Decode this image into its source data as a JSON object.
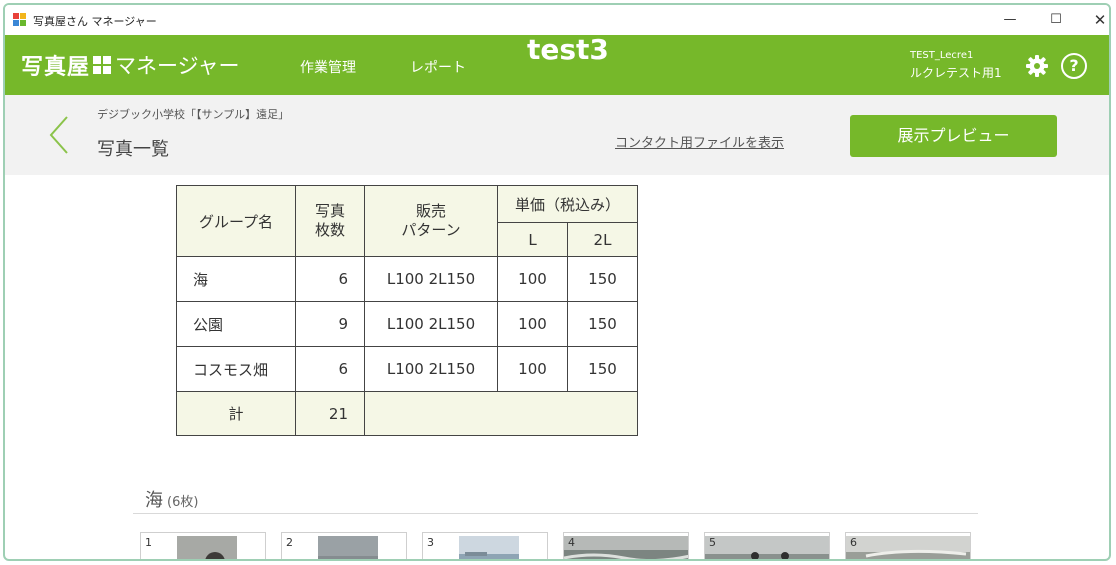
{
  "window": {
    "title": "写真屋さん マネージャー",
    "minimize": "—",
    "maximize": "☐",
    "close": "✕"
  },
  "header": {
    "brand_kanji": "写真屋",
    "brand_kana": "マネージャー",
    "nav": [
      "作業管理",
      "レポート"
    ],
    "center_label": "test3",
    "user_id": "TEST_Lecre1",
    "user_name": "ルクレテスト用1",
    "help_label": "?"
  },
  "subheader": {
    "breadcrumb": "デジブック小学校「【サンプル】遠足」",
    "title": "写真一覧",
    "contact_link": "コンタクト用ファイルを表示",
    "preview_button": "展示プレビュー"
  },
  "table": {
    "headers": {
      "group": "グループ名",
      "count": "写真\n枚数",
      "pattern": "販売\nパターン",
      "unit_price": "単価（税込み）",
      "price_l": "L",
      "price_2l": "2L"
    },
    "rows": [
      {
        "group": "海",
        "count": "6",
        "pattern": "L100 2L150",
        "l": "100",
        "l2": "150"
      },
      {
        "group": "公園",
        "count": "9",
        "pattern": "L100 2L150",
        "l": "100",
        "l2": "150"
      },
      {
        "group": "コスモス畑",
        "count": "6",
        "pattern": "L100 2L150",
        "l": "100",
        "l2": "150"
      }
    ],
    "total_label": "計",
    "total_count": "21"
  },
  "section": {
    "title": "海",
    "count_label": "(6枚)",
    "thumbnails": [
      "1",
      "2",
      "3",
      "4",
      "5",
      "6"
    ]
  },
  "colors": {
    "accent": "#76b82a",
    "table_header_bg": "#f5f7e6",
    "subheader_bg": "#f2f2f2"
  },
  "icons": [
    "app-icon",
    "gear-icon",
    "help-icon",
    "chevron-left-icon"
  ]
}
